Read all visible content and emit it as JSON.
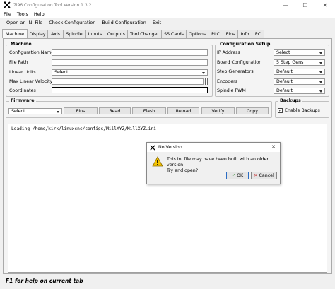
{
  "window": {
    "title": "7i96 Configuration Tool Version 1.3.2",
    "minimize": "—",
    "maximize": "☐",
    "close": "✕"
  },
  "menu": [
    "File",
    "Tools",
    "Help"
  ],
  "toolbar": [
    "Open an INI File",
    "Check Configuration",
    "Build Configuration",
    "Exit"
  ],
  "tabs": [
    {
      "label": "Machine",
      "active": true
    },
    {
      "label": "Display"
    },
    {
      "label": "Axis"
    },
    {
      "label": "Spindle"
    },
    {
      "label": "Inputs"
    },
    {
      "label": "Outputs"
    },
    {
      "label": "Tool Changer"
    },
    {
      "label": "SS Cards"
    },
    {
      "label": "Options"
    },
    {
      "label": "PLC"
    },
    {
      "label": "Pins"
    },
    {
      "label": "Info"
    },
    {
      "label": "PC"
    }
  ],
  "machine": {
    "title": "Machine",
    "config_name_label": "Configuration Name",
    "config_name_value": "",
    "file_path_label": "File Path",
    "file_path_value": "",
    "linear_units_label": "Linear Units",
    "linear_units_value": "Select",
    "max_linear_velocity_label": "Max Linear Velocity",
    "max_linear_velocity_value": "",
    "coordinates_label": "Coordinates",
    "coordinates_value": ""
  },
  "config_setup": {
    "title": "Configuration Setup",
    "ip_address_label": "IP Address",
    "ip_address_value": "Select",
    "board_config_label": "Board Configuration",
    "board_config_value": "5 Step Gens",
    "step_generators_label": "Step Generators",
    "step_generators_value": "Default",
    "encoders_label": "Encoders",
    "encoders_value": "Default",
    "spindle_pwm_label": "Spindle PWM",
    "spindle_pwm_value": "Default"
  },
  "firmware": {
    "title": "Firmware",
    "select_value": "Select",
    "buttons": [
      "Pins",
      "Read",
      "Flash",
      "Reload",
      "Verify",
      "Copy"
    ]
  },
  "backups": {
    "title": "Backups",
    "enable_label": "Enable Backups",
    "enabled": true,
    "check": "✓"
  },
  "output": {
    "text": "Loading /home/kirk/linuxcnc/configs/MillXYZ/MillXYZ.ini"
  },
  "status": "F1 for help on current tab",
  "dialog": {
    "title": "No Version",
    "message_line1": "This ini file may have been built with an older version",
    "message_line2": "Try and open?",
    "ok_label": "OK",
    "cancel_label": "Cancel",
    "close": "✕",
    "warning_glyph": "!",
    "ok_glyph": "✓",
    "cancel_glyph": "✕"
  }
}
